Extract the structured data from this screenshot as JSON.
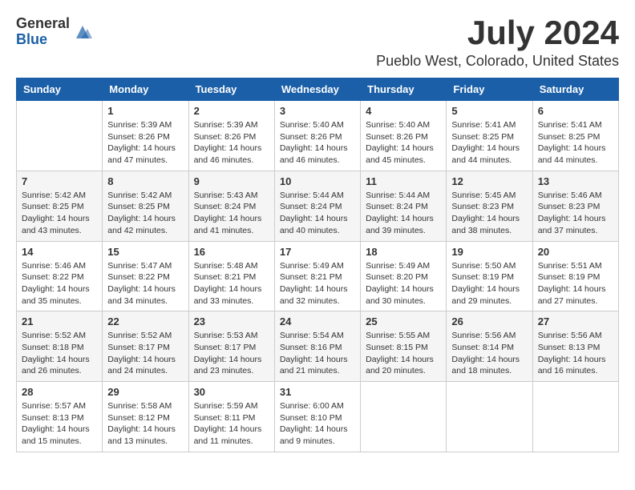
{
  "header": {
    "logo_general": "General",
    "logo_blue": "Blue",
    "month_title": "July 2024",
    "location": "Pueblo West, Colorado, United States"
  },
  "days_of_week": [
    "Sunday",
    "Monday",
    "Tuesday",
    "Wednesday",
    "Thursday",
    "Friday",
    "Saturday"
  ],
  "weeks": [
    [
      {
        "day": "",
        "info": ""
      },
      {
        "day": "1",
        "info": "Sunrise: 5:39 AM\nSunset: 8:26 PM\nDaylight: 14 hours\nand 47 minutes."
      },
      {
        "day": "2",
        "info": "Sunrise: 5:39 AM\nSunset: 8:26 PM\nDaylight: 14 hours\nand 46 minutes."
      },
      {
        "day": "3",
        "info": "Sunrise: 5:40 AM\nSunset: 8:26 PM\nDaylight: 14 hours\nand 46 minutes."
      },
      {
        "day": "4",
        "info": "Sunrise: 5:40 AM\nSunset: 8:26 PM\nDaylight: 14 hours\nand 45 minutes."
      },
      {
        "day": "5",
        "info": "Sunrise: 5:41 AM\nSunset: 8:25 PM\nDaylight: 14 hours\nand 44 minutes."
      },
      {
        "day": "6",
        "info": "Sunrise: 5:41 AM\nSunset: 8:25 PM\nDaylight: 14 hours\nand 44 minutes."
      }
    ],
    [
      {
        "day": "7",
        "info": "Sunrise: 5:42 AM\nSunset: 8:25 PM\nDaylight: 14 hours\nand 43 minutes."
      },
      {
        "day": "8",
        "info": "Sunrise: 5:42 AM\nSunset: 8:25 PM\nDaylight: 14 hours\nand 42 minutes."
      },
      {
        "day": "9",
        "info": "Sunrise: 5:43 AM\nSunset: 8:24 PM\nDaylight: 14 hours\nand 41 minutes."
      },
      {
        "day": "10",
        "info": "Sunrise: 5:44 AM\nSunset: 8:24 PM\nDaylight: 14 hours\nand 40 minutes."
      },
      {
        "day": "11",
        "info": "Sunrise: 5:44 AM\nSunset: 8:24 PM\nDaylight: 14 hours\nand 39 minutes."
      },
      {
        "day": "12",
        "info": "Sunrise: 5:45 AM\nSunset: 8:23 PM\nDaylight: 14 hours\nand 38 minutes."
      },
      {
        "day": "13",
        "info": "Sunrise: 5:46 AM\nSunset: 8:23 PM\nDaylight: 14 hours\nand 37 minutes."
      }
    ],
    [
      {
        "day": "14",
        "info": "Sunrise: 5:46 AM\nSunset: 8:22 PM\nDaylight: 14 hours\nand 35 minutes."
      },
      {
        "day": "15",
        "info": "Sunrise: 5:47 AM\nSunset: 8:22 PM\nDaylight: 14 hours\nand 34 minutes."
      },
      {
        "day": "16",
        "info": "Sunrise: 5:48 AM\nSunset: 8:21 PM\nDaylight: 14 hours\nand 33 minutes."
      },
      {
        "day": "17",
        "info": "Sunrise: 5:49 AM\nSunset: 8:21 PM\nDaylight: 14 hours\nand 32 minutes."
      },
      {
        "day": "18",
        "info": "Sunrise: 5:49 AM\nSunset: 8:20 PM\nDaylight: 14 hours\nand 30 minutes."
      },
      {
        "day": "19",
        "info": "Sunrise: 5:50 AM\nSunset: 8:19 PM\nDaylight: 14 hours\nand 29 minutes."
      },
      {
        "day": "20",
        "info": "Sunrise: 5:51 AM\nSunset: 8:19 PM\nDaylight: 14 hours\nand 27 minutes."
      }
    ],
    [
      {
        "day": "21",
        "info": "Sunrise: 5:52 AM\nSunset: 8:18 PM\nDaylight: 14 hours\nand 26 minutes."
      },
      {
        "day": "22",
        "info": "Sunrise: 5:52 AM\nSunset: 8:17 PM\nDaylight: 14 hours\nand 24 minutes."
      },
      {
        "day": "23",
        "info": "Sunrise: 5:53 AM\nSunset: 8:17 PM\nDaylight: 14 hours\nand 23 minutes."
      },
      {
        "day": "24",
        "info": "Sunrise: 5:54 AM\nSunset: 8:16 PM\nDaylight: 14 hours\nand 21 minutes."
      },
      {
        "day": "25",
        "info": "Sunrise: 5:55 AM\nSunset: 8:15 PM\nDaylight: 14 hours\nand 20 minutes."
      },
      {
        "day": "26",
        "info": "Sunrise: 5:56 AM\nSunset: 8:14 PM\nDaylight: 14 hours\nand 18 minutes."
      },
      {
        "day": "27",
        "info": "Sunrise: 5:56 AM\nSunset: 8:13 PM\nDaylight: 14 hours\nand 16 minutes."
      }
    ],
    [
      {
        "day": "28",
        "info": "Sunrise: 5:57 AM\nSunset: 8:13 PM\nDaylight: 14 hours\nand 15 minutes."
      },
      {
        "day": "29",
        "info": "Sunrise: 5:58 AM\nSunset: 8:12 PM\nDaylight: 14 hours\nand 13 minutes."
      },
      {
        "day": "30",
        "info": "Sunrise: 5:59 AM\nSunset: 8:11 PM\nDaylight: 14 hours\nand 11 minutes."
      },
      {
        "day": "31",
        "info": "Sunrise: 6:00 AM\nSunset: 8:10 PM\nDaylight: 14 hours\nand 9 minutes."
      },
      {
        "day": "",
        "info": ""
      },
      {
        "day": "",
        "info": ""
      },
      {
        "day": "",
        "info": ""
      }
    ]
  ]
}
